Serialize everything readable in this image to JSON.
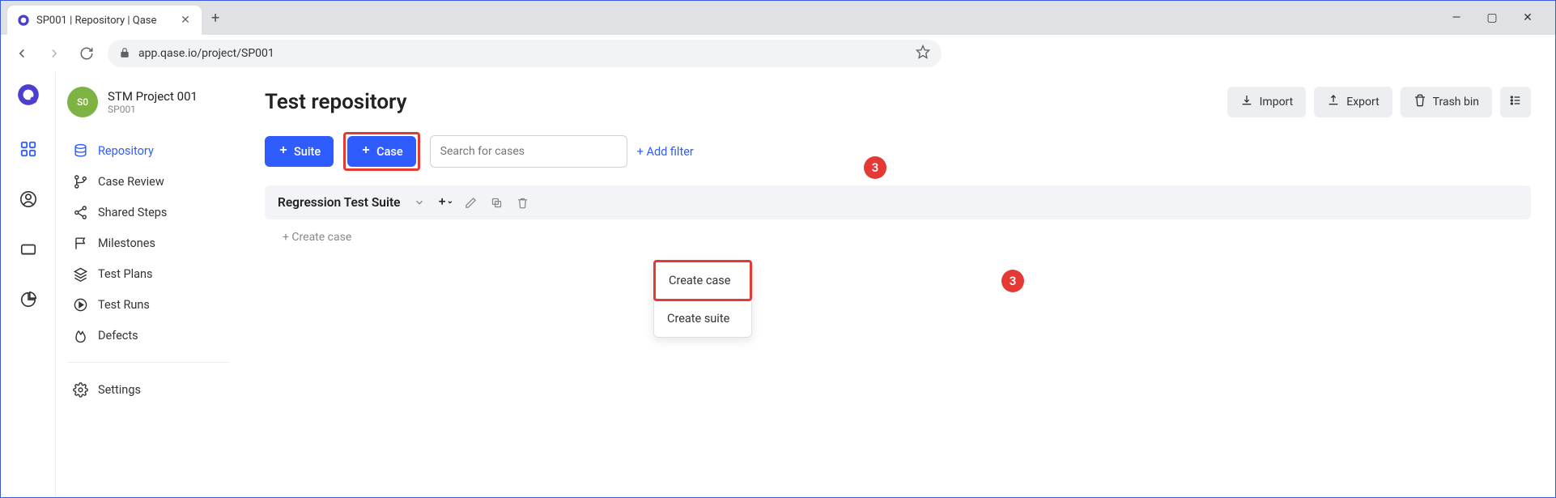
{
  "browser": {
    "tab_title": "SP001 | Repository | Qase",
    "url": "app.qase.io/project/SP001"
  },
  "project": {
    "name": "STM Project 001",
    "code": "SP001",
    "avatar_initials": "S0"
  },
  "sidebar": {
    "items": [
      {
        "label": "Repository"
      },
      {
        "label": "Case Review"
      },
      {
        "label": "Shared Steps"
      },
      {
        "label": "Milestones"
      },
      {
        "label": "Test Plans"
      },
      {
        "label": "Test Runs"
      },
      {
        "label": "Defects"
      }
    ],
    "settings_label": "Settings"
  },
  "page": {
    "title": "Test repository",
    "actions": {
      "import": "Import",
      "export": "Export",
      "trash": "Trash bin"
    }
  },
  "toolbar": {
    "suite_btn": "Suite",
    "case_btn": "Case",
    "search_placeholder": "Search for cases",
    "add_filter": "+ Add filter"
  },
  "suite": {
    "title": "Regression Test Suite",
    "create_case": "+ Create case"
  },
  "dropdown": {
    "create_case": "Create case",
    "create_suite": "Create suite"
  },
  "annotations": {
    "num": "3"
  }
}
